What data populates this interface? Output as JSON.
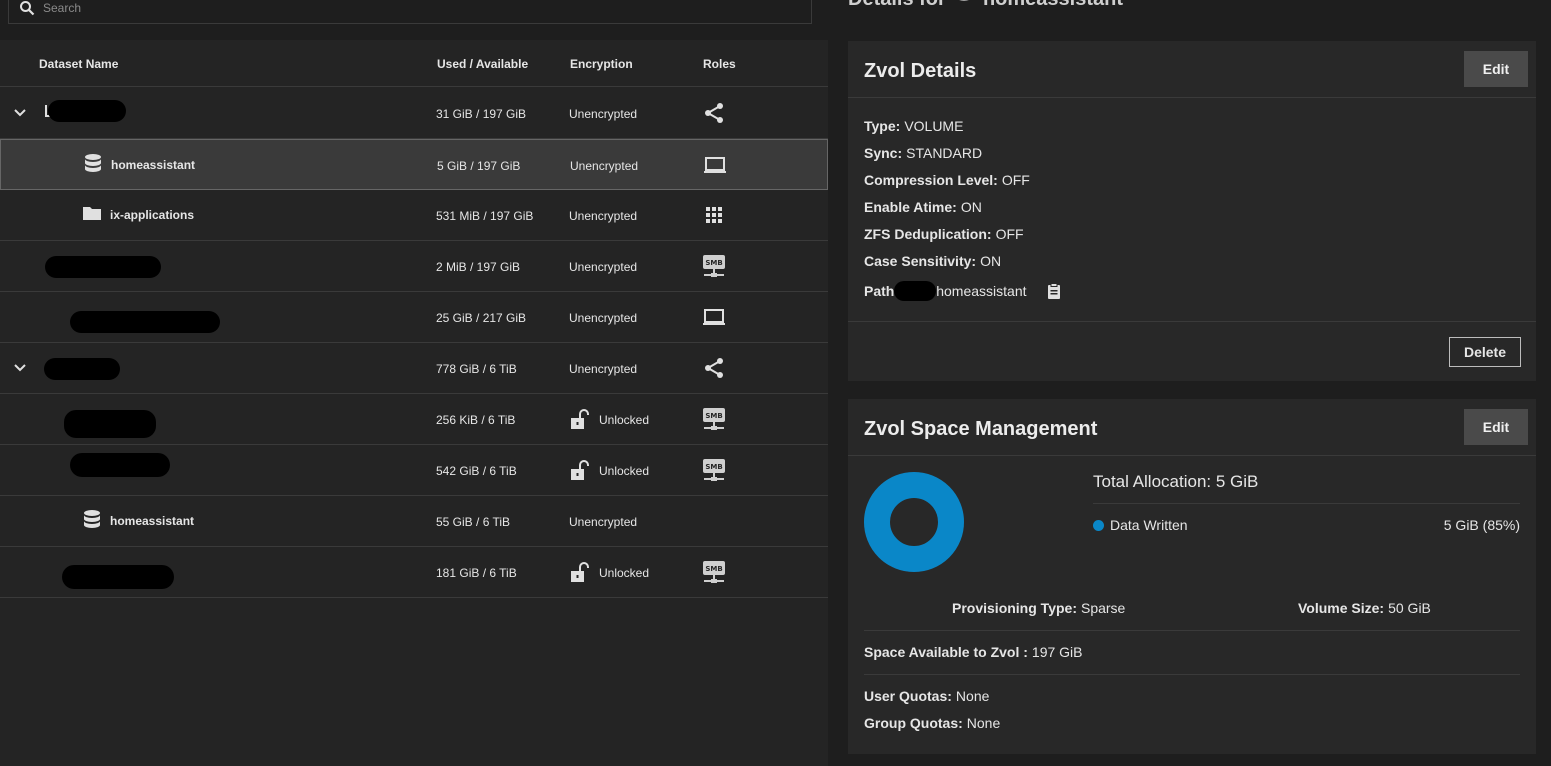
{
  "search": {
    "placeholder": "Search"
  },
  "table": {
    "headers": {
      "name": "Dataset Name",
      "used": "Used / Available",
      "encryption": "Encryption",
      "roles": "Roles"
    },
    "rows": [
      {
        "name": "",
        "used": "31 GiB / 197 GiB",
        "encryption": "Unencrypted",
        "role_icon": "share-icon",
        "type_icon": "pool-icon",
        "expand": true
      },
      {
        "name": "homeassistant",
        "used": "5 GiB / 197 GiB",
        "encryption": "Unencrypted",
        "role_icon": "laptop-icon",
        "type_icon": "database-icon",
        "selected": true
      },
      {
        "name": "ix-applications",
        "used": "531 MiB / 197 GiB",
        "encryption": "Unencrypted",
        "role_icon": "apps-grid-icon",
        "type_icon": "folder-icon"
      },
      {
        "name": "",
        "used": "2 MiB / 197 GiB",
        "encryption": "Unencrypted",
        "role_icon": "smb-icon",
        "type_icon": "folder-icon"
      },
      {
        "name": "",
        "used": "25 GiB / 217 GiB",
        "encryption": "Unencrypted",
        "role_icon": "laptop-icon",
        "type_icon": "database-icon"
      },
      {
        "name": "",
        "used": "778 GiB / 6 TiB",
        "encryption": "Unencrypted",
        "role_icon": "share-icon",
        "type_icon": "pool-icon",
        "expand": true
      },
      {
        "name": "",
        "used": "256 KiB / 6 TiB",
        "encryption": "Unlocked",
        "role_icon": "smb-icon",
        "type_icon": "folder-icon"
      },
      {
        "name": "",
        "used": "542 GiB / 6 TiB",
        "encryption": "Unlocked",
        "role_icon": "smb-icon",
        "type_icon": "folder-icon"
      },
      {
        "name": "homeassistant",
        "used": "55 GiB / 6 TiB",
        "encryption": "Unencrypted",
        "role_icon": "",
        "type_icon": "database-icon"
      },
      {
        "name": "",
        "used": "181 GiB / 6 TiB",
        "encryption": "Unlocked",
        "role_icon": "smb-icon",
        "type_icon": "folder-icon"
      }
    ]
  },
  "details": {
    "heading_prefix": "Details for",
    "heading_name": "homeassistant"
  },
  "zvol_details": {
    "title": "Zvol Details",
    "edit_label": "Edit",
    "delete_label": "Delete",
    "type_label": "Type:",
    "type_value": "VOLUME",
    "sync_label": "Sync:",
    "sync_value": "STANDARD",
    "compression_label": "Compression Level:",
    "compression_value": "OFF",
    "atime_label": "Enable Atime:",
    "atime_value": "ON",
    "dedup_label": "ZFS Deduplication:",
    "dedup_value": "OFF",
    "case_label": "Case Sensitivity:",
    "case_value": "ON",
    "path_label": "Path",
    "path_value": "homeassistant"
  },
  "space": {
    "title": "Zvol Space Management",
    "edit_label": "Edit",
    "total_label": "Total Allocation:",
    "total_value": "5 GiB",
    "legend_label": "Data Written",
    "legend_value": "5 GiB (85%)",
    "data_written_fraction": 1.0,
    "provisioning_label": "Provisioning Type:",
    "provisioning_value": "Sparse",
    "volsize_label": "Volume Size:",
    "volsize_value": "50 GiB",
    "avail_label": "Space Available to Zvol :",
    "avail_value": "197 GiB",
    "user_quota_label": "User Quotas:",
    "user_quota_value": "None",
    "group_quota_label": "Group Quotas:",
    "group_quota_value": "None"
  },
  "colors": {
    "accent": "#0a87c8",
    "bg": "#1e1e1e",
    "card": "#282828"
  }
}
